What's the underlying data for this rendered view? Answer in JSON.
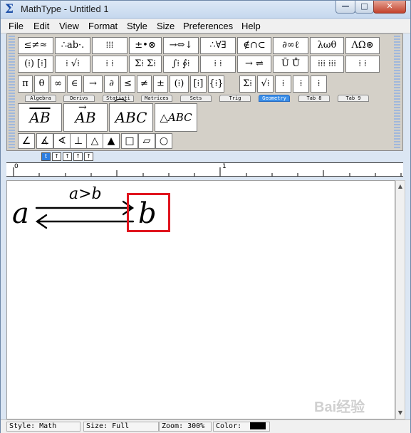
{
  "window": {
    "title": "MathType - Untitled 1"
  },
  "window_controls": {
    "minimize": "—",
    "maximize": "□",
    "close": "✕"
  },
  "menu": [
    "File",
    "Edit",
    "View",
    "Format",
    "Style",
    "Size",
    "Preferences",
    "Help"
  ],
  "palette_row1": [
    "≤≠≈",
    "∴ab·.",
    "⁞⁞⁞",
    "±•⊗",
    "→⇔↓",
    "∴∀∃",
    "∉∩⊂",
    "∂∞ℓ",
    "λωθ",
    "ΛΩ⊛"
  ],
  "palette_row2": [
    "(⁞) [⁞]",
    "⁞ √⁞",
    "⁞ ⁞",
    "Σ⁞ Σ⁞",
    "∫⁞ ∮⁞",
    "⁞ ⁞",
    "→ ⇌",
    "Ū Ů",
    "⁞⁞⁞ ⁞⁞⁞",
    "⁞ ⁞"
  ],
  "palette_row3": [
    "π",
    "θ",
    "∞",
    "∈",
    "→",
    "∂",
    "≤",
    "≠",
    "±",
    "(⁞)",
    "[⁞]",
    "{⁞}",
    "Σ⁞",
    "√⁞",
    "⁞",
    "⁞",
    "⁞"
  ],
  "tabs": [
    "Algebra",
    "Derivs",
    "Statisti",
    "Matrices",
    "Sets",
    "Trig",
    "Geometry",
    "Tab 8",
    "Tab 9"
  ],
  "active_tab": "Geometry",
  "templates": [
    "AB",
    "AB",
    "ABC",
    "△ABC"
  ],
  "geometry_symbols": [
    "∠",
    "∡",
    "∢",
    "⊥",
    "△",
    "▲",
    "□",
    "▱",
    "○"
  ],
  "size_tabs": [
    "t",
    "↑",
    "↑",
    "↑",
    "↑"
  ],
  "ruler": {
    "mark0": "0",
    "mark1": "1"
  },
  "equation": {
    "left": "a",
    "right": "b",
    "condition": "a>b"
  },
  "status": {
    "style": "Style: Math",
    "size": "Size: Full",
    "zoom": "Zoom: 300%",
    "color": "Color:"
  },
  "colors": {
    "highlight": "#e0141e",
    "active_tab": "#3a8ee8"
  },
  "watermark": "Bai经验"
}
